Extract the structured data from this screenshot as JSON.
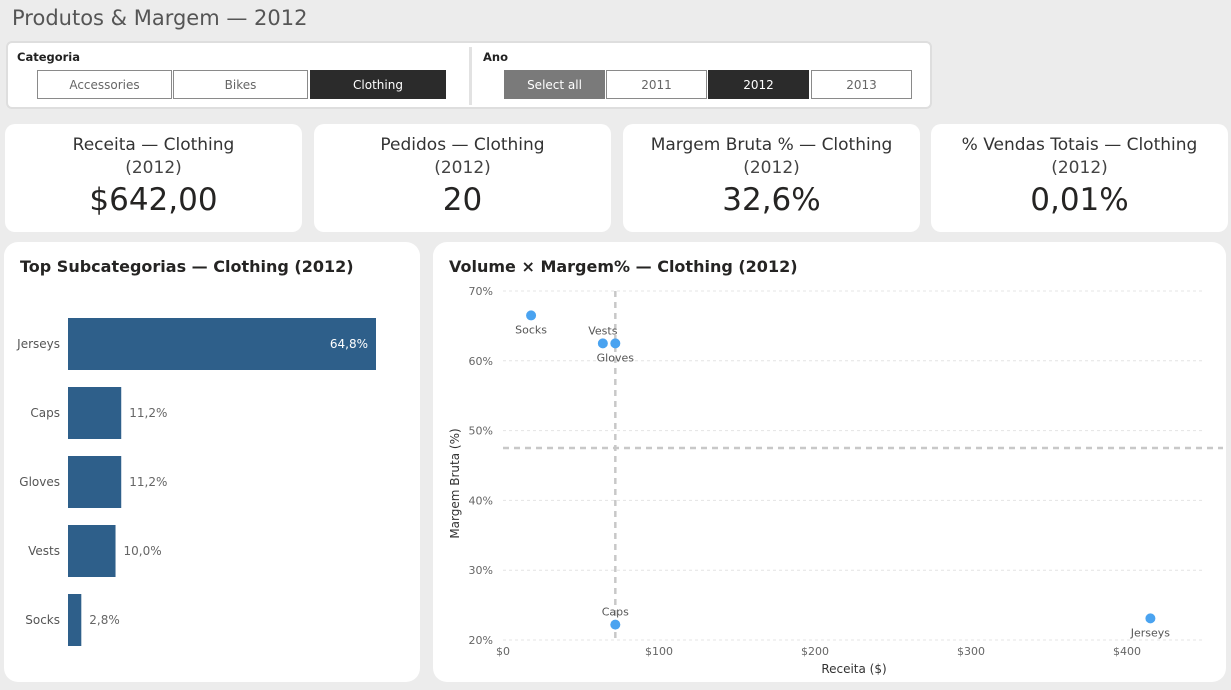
{
  "page": {
    "title": "Produtos & Margem — 2012"
  },
  "slicers": {
    "categoria": {
      "label": "Categoria",
      "options": [
        {
          "label": "Accessories",
          "selected": false
        },
        {
          "label": "Bikes",
          "selected": false
        },
        {
          "label": "Clothing",
          "selected": true
        }
      ]
    },
    "ano": {
      "label": "Ano",
      "options": [
        {
          "label": "Select all",
          "selected": false
        },
        {
          "label": "2011",
          "selected": false
        },
        {
          "label": "2012",
          "selected": true
        },
        {
          "label": "2013",
          "selected": false
        }
      ]
    }
  },
  "kpis": [
    {
      "title": "Receita — Clothing",
      "sub": "(2012)",
      "value": "$642,00"
    },
    {
      "title": "Pedidos — Clothing",
      "sub": "(2012)",
      "value": "20"
    },
    {
      "title": "Margem Bruta % — Clothing",
      "sub": "(2012)",
      "value": "32,6%"
    },
    {
      "title": "% Vendas Totais — Clothing",
      "sub": "(2012)",
      "value": "0,01%"
    }
  ],
  "colors": {
    "bar": "#2e5f8a",
    "point": "#4aa3f0",
    "guide": "#c8c8c8"
  },
  "chart_data": [
    {
      "type": "bar",
      "orientation": "horizontal",
      "title": "Top Subcategorias — Clothing (2012)",
      "categories": [
        "Jerseys",
        "Caps",
        "Gloves",
        "Vests",
        "Socks"
      ],
      "values": [
        64.8,
        11.2,
        11.2,
        10.0,
        2.8
      ],
      "labels": [
        "64,8%",
        "11,2%",
        "11,2%",
        "10,0%",
        "2,8%"
      ]
    },
    {
      "type": "scatter",
      "title": "Volume × Margem% — Clothing (2012)",
      "xlabel": "Receita ($)",
      "ylabel": "Margem Bruta (%)",
      "xlim": [
        0,
        450
      ],
      "ylim": [
        20,
        70
      ],
      "xticks": [
        0,
        100,
        200,
        300,
        400
      ],
      "xtick_labels": [
        "$0",
        "$100",
        "$200",
        "$300",
        "$400"
      ],
      "yticks": [
        20,
        30,
        40,
        50,
        60,
        70
      ],
      "ytick_labels": [
        "20%",
        "30%",
        "40%",
        "50%",
        "60%",
        "70%"
      ],
      "grid": true,
      "reference_lines": {
        "x": 72,
        "y": 47.5
      },
      "points": [
        {
          "label": "Socks",
          "x": 18,
          "y": 66.5
        },
        {
          "label": "Vests",
          "x": 64,
          "y": 62.5
        },
        {
          "label": "Gloves",
          "x": 72,
          "y": 62.5
        },
        {
          "label": "Caps",
          "x": 72,
          "y": 22.2
        },
        {
          "label": "Jerseys",
          "x": 415,
          "y": 23.1
        }
      ]
    }
  ]
}
